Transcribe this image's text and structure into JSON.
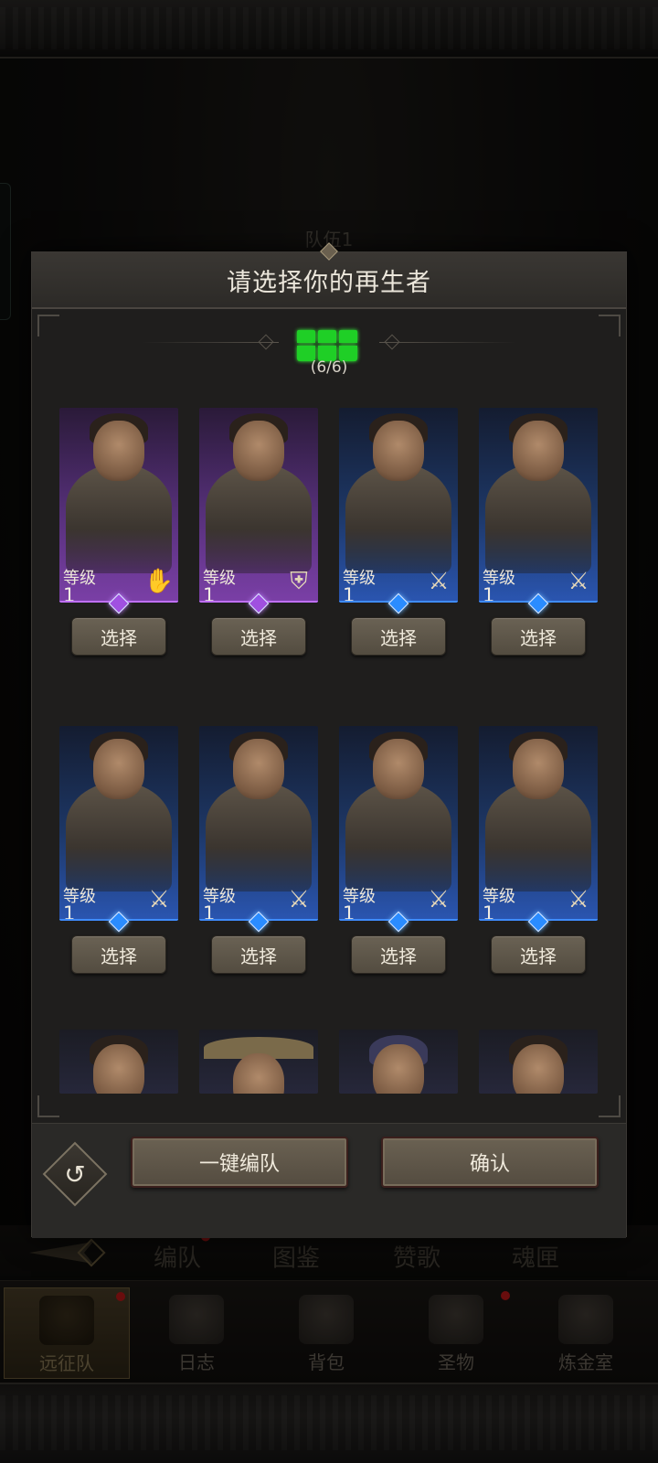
{
  "background": {
    "team_label": "队伍1",
    "subtabs": [
      {
        "label": "编队",
        "dot": true
      },
      {
        "label": "图鉴",
        "dot": false
      },
      {
        "label": "赞歌",
        "dot": false
      },
      {
        "label": "魂匣",
        "dot": false
      }
    ],
    "nav": [
      {
        "label": "远征队",
        "icon": "helmet-icon",
        "active": true,
        "dot": true
      },
      {
        "label": "日志",
        "icon": "map-scroll-icon",
        "active": false,
        "dot": false
      },
      {
        "label": "背包",
        "icon": "bag-icon",
        "active": false,
        "dot": false
      },
      {
        "label": "圣物",
        "icon": "torch-icon",
        "active": false,
        "dot": true
      },
      {
        "label": "炼金室",
        "icon": "alchemy-icon",
        "active": false,
        "dot": false
      }
    ]
  },
  "dialog": {
    "title": "请选择你的再生者",
    "slots_filled": 6,
    "slots_total": 6,
    "slots_text": "(6/6)",
    "slot_color": "#1fcf26",
    "level_label": "等级",
    "select_label": "选择",
    "heroes": [
      {
        "level": "1",
        "rarity": "purple",
        "class_icon": "hand-icon"
      },
      {
        "level": "1",
        "rarity": "purple",
        "class_icon": "shield-icon"
      },
      {
        "level": "1",
        "rarity": "blue",
        "class_icon": "sword-icon"
      },
      {
        "level": "1",
        "rarity": "blue",
        "class_icon": "sword-icon"
      },
      {
        "level": "1",
        "rarity": "blue",
        "class_icon": "sword-icon"
      },
      {
        "level": "1",
        "rarity": "blue",
        "class_icon": "sword-icon"
      },
      {
        "level": "1",
        "rarity": "blue",
        "class_icon": "sword-icon"
      },
      {
        "level": "1",
        "rarity": "blue",
        "class_icon": "sword-icon"
      }
    ],
    "footer": {
      "auto_label": "一键编队",
      "confirm_label": "确认",
      "undo_icon": "undo-icon"
    }
  }
}
